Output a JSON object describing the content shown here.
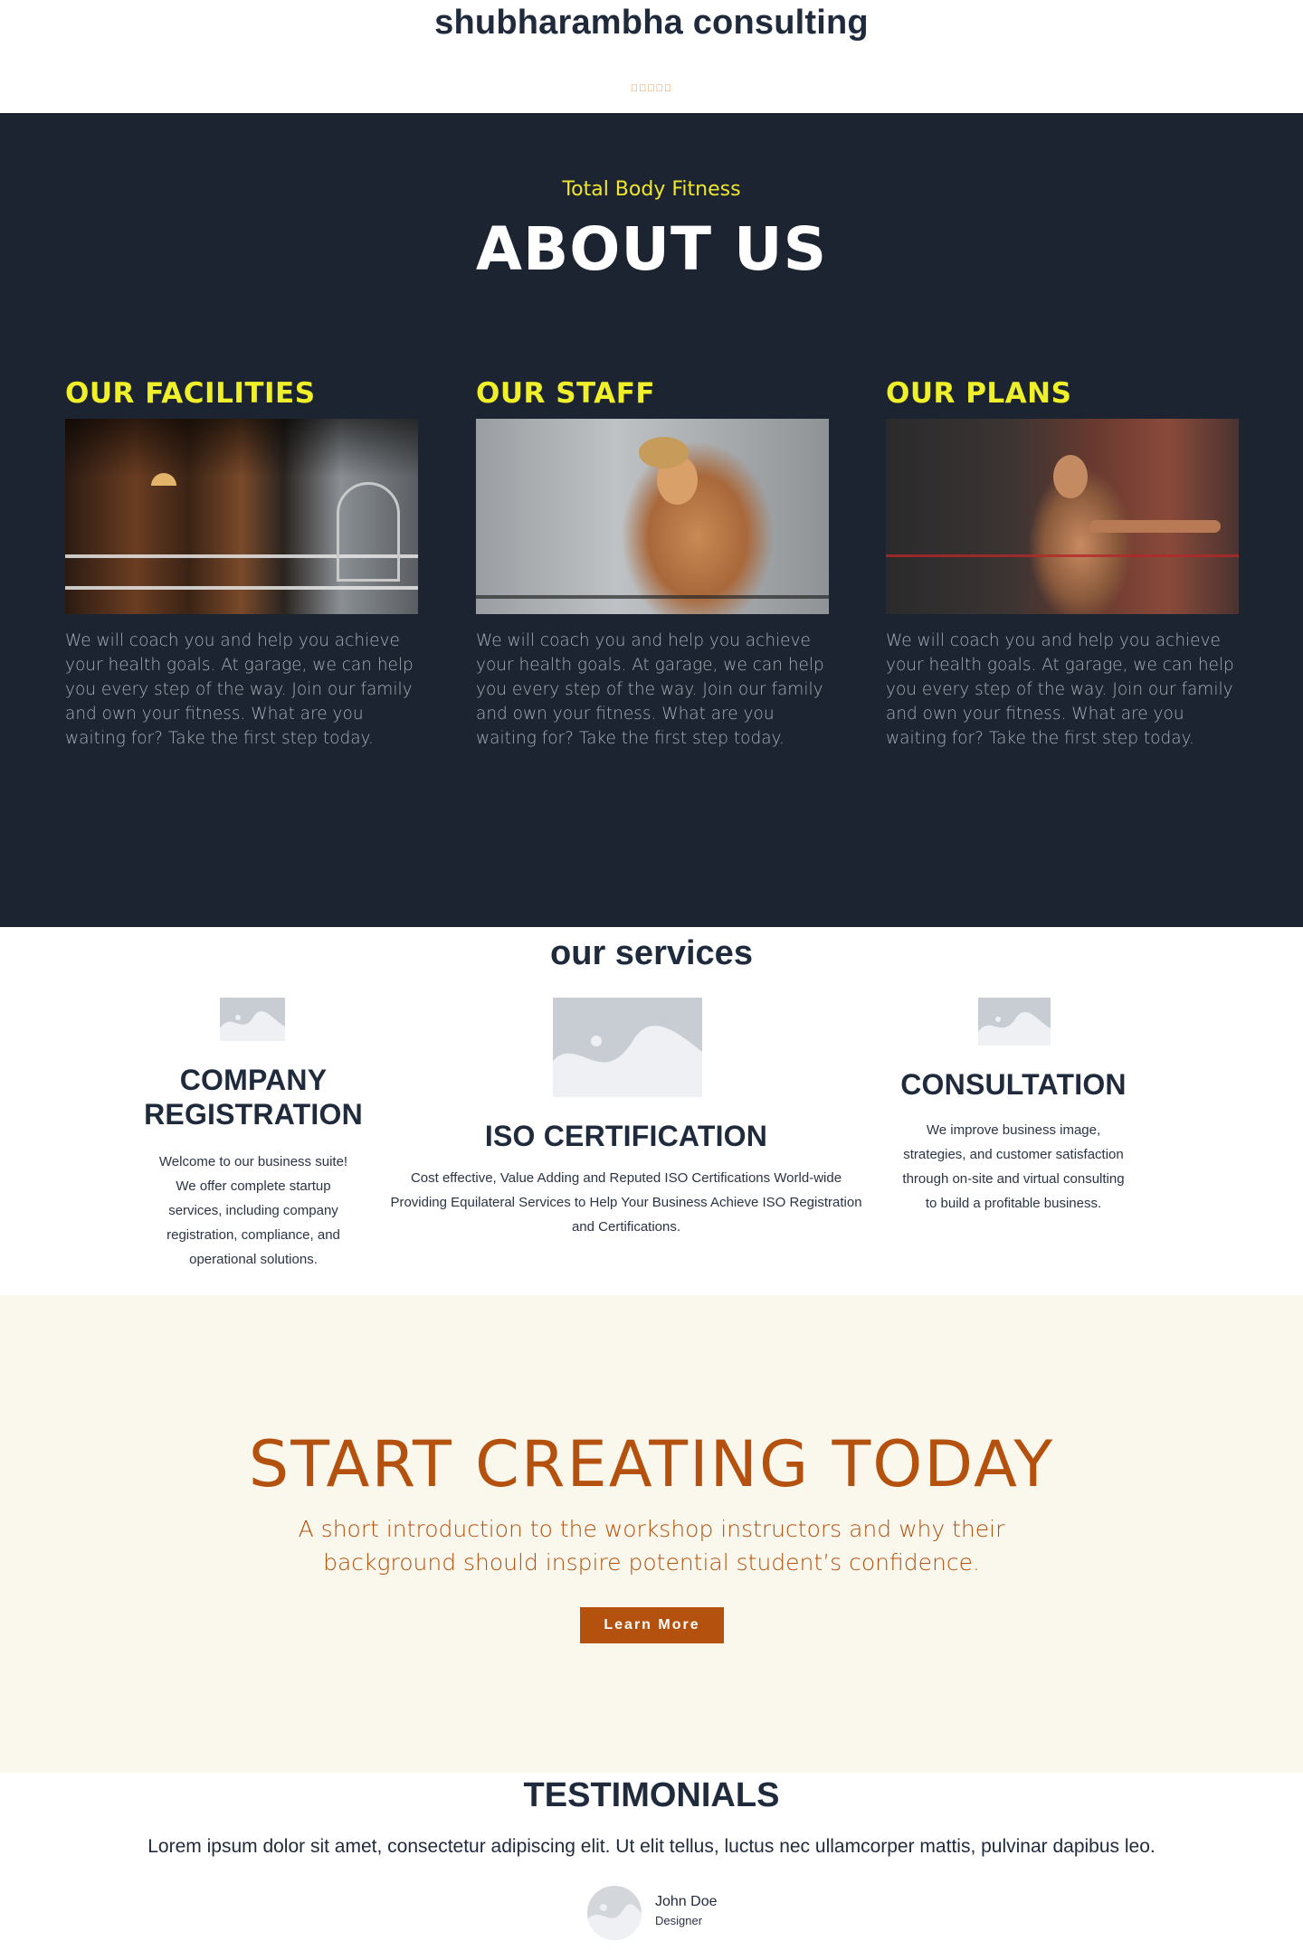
{
  "header": {
    "site_title": "shubharambha consulting",
    "language_glyphs": "􏿽􏿽􏿽􏿽􏿽"
  },
  "about": {
    "eyebrow": "Total Body Fitness",
    "title": "ABOUT US",
    "columns": [
      {
        "heading": "OUR FACILITIES",
        "image_subject": "gym interior with boxing ring",
        "text": "We will coach you and help you achieve your health goals. At garage, we can help you every step of the way. Join our family and own your fitness. What are you waiting for? Take the first step today."
      },
      {
        "heading": "OUR STAFF",
        "image_subject": "boxer with white gloves",
        "text": "We will coach you and help you achieve your health goals. At garage, we can help you every step of the way. Join our family and own your fitness. What are you waiting for? Take the first step today."
      },
      {
        "heading": "OUR PLANS",
        "image_subject": "woman exercising with arms extended",
        "text": "We will coach you and help you achieve your health goals. At garage, we can help you every step of the way. Join our family and own your fitness. What are you waiting for? Take the first step today."
      }
    ]
  },
  "services": {
    "title": "our services",
    "items": [
      {
        "heading_line1": "COMPANY",
        "heading_line2": "REGISTRATION",
        "lines": [
          "Welcome to our business suite!",
          "We offer complete startup",
          "services, including company",
          "registration, compliance, and",
          "operational solutions."
        ]
      },
      {
        "heading": "ISO CERTIFICATION",
        "lines": [
          "Cost effective, Value Adding and Reputed ISO Certifications World-wide",
          "Providing Equilateral Services to Help Your Business Achieve ISO Registration",
          "and Certifications."
        ]
      },
      {
        "heading": "CONSULTATION",
        "lines": [
          "We improve business image,",
          "strategies, and customer satisfaction",
          "through on-site and virtual consulting",
          "to build a profitable business."
        ]
      }
    ]
  },
  "cta": {
    "title": "START CREATING TODAY",
    "subtitle_line1": "A short introduction to the workshop instructors and why their",
    "subtitle_line2": "background should inspire potential student’s confidence.",
    "button_label": "Learn More",
    "color": "#b5510f"
  },
  "testimonials": {
    "title": "TESTIMONIALS",
    "quote": "Lorem ipsum dolor sit amet, consectetur adipiscing elit. Ut elit tellus, luctus nec ullamcorper mattis, pulvinar dapibus leo.",
    "name": "John Doe",
    "role": "Designer"
  },
  "colors": {
    "dark_bg": "#1b2430",
    "accent_yellow": "#f0f02a",
    "cta_bg": "#faf7ec",
    "text_dark": "#1f2a3c"
  }
}
